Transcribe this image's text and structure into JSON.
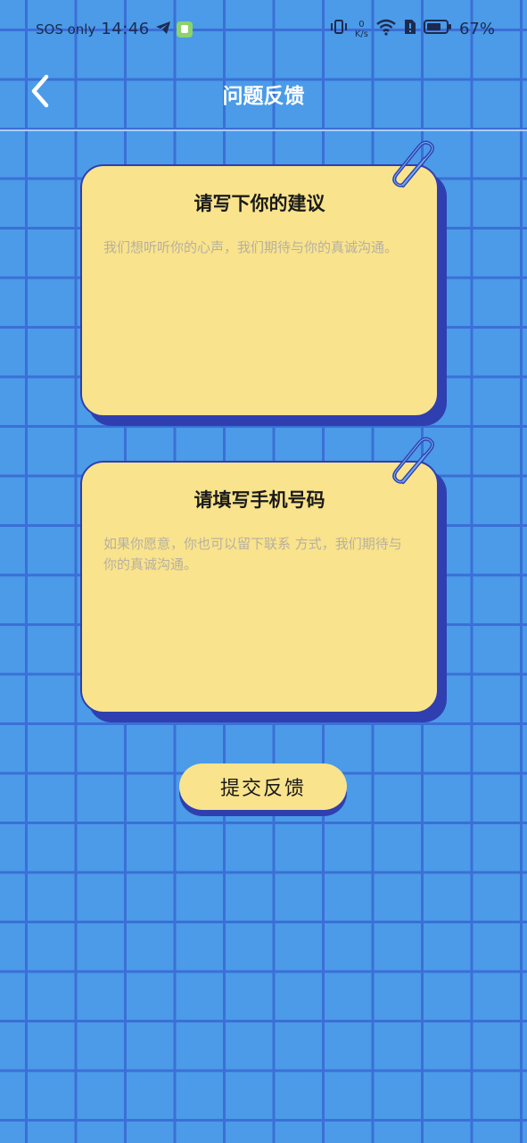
{
  "status_bar": {
    "sos": "SOS only",
    "time": "14:46",
    "net_speed_value": "0",
    "net_speed_unit": "K/s",
    "battery": "67%"
  },
  "header": {
    "title": "问题反馈"
  },
  "suggestion_card": {
    "title": "请写下你的建议",
    "placeholder": "我们想听听你的心声，我们期待与你的真诚沟通。"
  },
  "phone_card": {
    "title": "请填写手机号码",
    "placeholder": "如果你愿意，你也可以留下联系 方式，我们期待与你的真诚沟通。"
  },
  "submit": {
    "label": "提交反馈"
  },
  "colors": {
    "background": "#4b9be8",
    "grid_line": "#3b6fd6",
    "card": "#f9e38c",
    "card_border": "#2f3fb0"
  }
}
